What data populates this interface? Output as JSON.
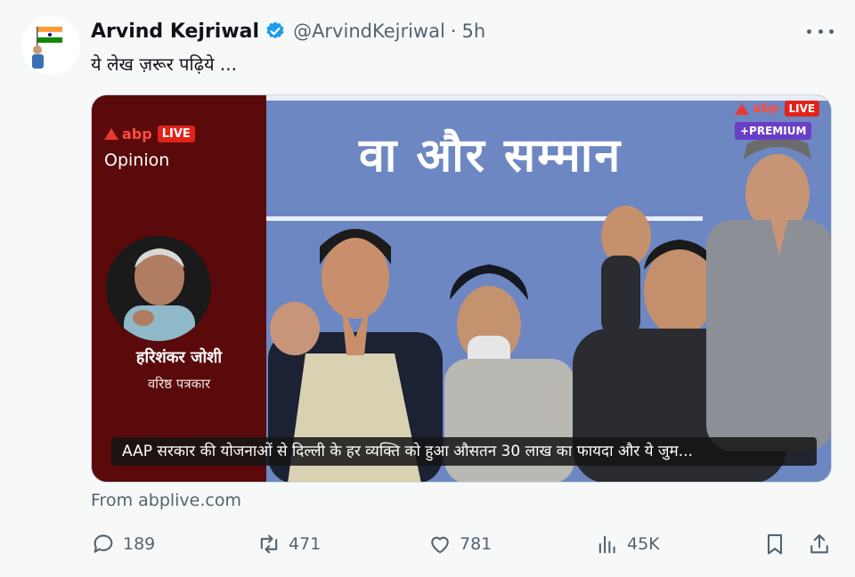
{
  "tweet": {
    "display_name": "Arvind Kejriwal",
    "handle": "@ArvindKejriwal",
    "separator": "·",
    "time": "5h",
    "text": "ये लेख ज़रूर पढ़िये ..."
  },
  "card": {
    "abp_left": "abp",
    "live_left": "LIVE",
    "opinion": "Opinion",
    "author_name": "हरिशंकर जोशी",
    "author_title": "वरिष्ठ पत्रकार",
    "banner_text": "वा और सम्मान",
    "abp_right": "abp",
    "live_right": "LIVE",
    "premium": "+PREMIUM",
    "caption": "AAP सरकार की योजनाओं से दिल्ली के हर व्यक्ति को हुआ औसतन 30 लाख का फायदा और ये जुम..."
  },
  "source": "From abplive.com",
  "actions": {
    "replies": "189",
    "retweets": "471",
    "likes": "781",
    "views": "45K"
  },
  "colors": {
    "accent": "#1d9bf0",
    "muted": "#536471",
    "card_side": "#5a0a0a",
    "abp_red": "#e2231a"
  },
  "icons": [
    "verified-badge-icon",
    "more-icon",
    "reply-icon",
    "retweet-icon",
    "like-icon",
    "views-icon",
    "bookmark-icon",
    "share-icon"
  ]
}
